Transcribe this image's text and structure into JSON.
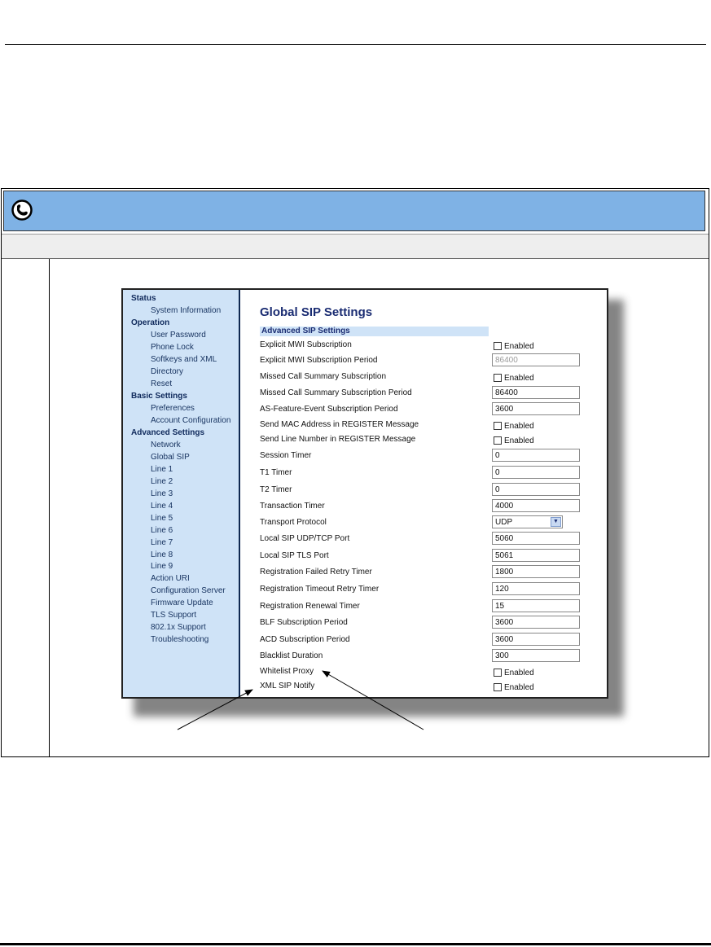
{
  "nav": {
    "groups": {
      "status": "Status",
      "operation": "Operation",
      "basic": "Basic Settings",
      "advanced": "Advanced Settings"
    },
    "items": {
      "system_information": "System Information",
      "user_password": "User Password",
      "phone_lock": "Phone Lock",
      "softkeys_xml": "Softkeys and XML",
      "directory": "Directory",
      "reset": "Reset",
      "preferences": "Preferences",
      "account_configuration": "Account Configuration",
      "network": "Network",
      "global_sip": "Global SIP",
      "line1": "Line 1",
      "line2": "Line 2",
      "line3": "Line 3",
      "line4": "Line 4",
      "line5": "Line 5",
      "line6": "Line 6",
      "line7": "Line 7",
      "line8": "Line 8",
      "line9": "Line 9",
      "action_uri": "Action URI",
      "configuration_server": "Configuration Server",
      "firmware_update": "Firmware Update",
      "tls_support": "TLS Support",
      "dot1x_support": "802.1x Support",
      "troubleshooting": "Troubleshooting"
    }
  },
  "panel": {
    "title": "Global SIP Settings",
    "section": "Advanced SIP Settings",
    "enabled_label": "Enabled",
    "rows": {
      "explicit_mwi": "Explicit MWI Subscription",
      "explicit_mwi_period": "Explicit MWI Subscription Period",
      "missed_call": "Missed Call Summary Subscription",
      "missed_call_period": "Missed Call Summary Subscription Period",
      "as_feature_period": "AS-Feature-Event Subscription Period",
      "send_mac": "Send MAC Address in REGISTER Message",
      "send_line": "Send Line Number in REGISTER Message",
      "session_timer": "Session Timer",
      "t1_timer": "T1 Timer",
      "t2_timer": "T2 Timer",
      "transaction_timer": "Transaction Timer",
      "transport_protocol": "Transport Protocol",
      "local_udp_tcp": "Local SIP UDP/TCP Port",
      "local_tls": "Local SIP TLS Port",
      "reg_failed": "Registration Failed Retry Timer",
      "reg_timeout": "Registration Timeout Retry Timer",
      "reg_renewal": "Registration Renewal Timer",
      "blf_period": "BLF Subscription Period",
      "acd_period": "ACD Subscription Period",
      "blacklist": "Blacklist Duration",
      "whitelist": "Whitelist Proxy",
      "xml_notify": "XML SIP Notify"
    },
    "values": {
      "explicit_mwi_period": "86400",
      "missed_call_period": "86400",
      "as_feature_period": "3600",
      "session_timer": "0",
      "t1_timer": "0",
      "t2_timer": "0",
      "transaction_timer": "4000",
      "transport_protocol": "UDP",
      "local_udp_tcp": "5060",
      "local_tls": "5061",
      "reg_failed": "1800",
      "reg_timeout": "120",
      "reg_renewal": "15",
      "blf_period": "3600",
      "acd_period": "3600",
      "blacklist": "300"
    }
  },
  "colors": {
    "header_bar": "#7fb2e5",
    "nav_background": "#cfe3f7",
    "title_blue": "#1a2c72"
  }
}
